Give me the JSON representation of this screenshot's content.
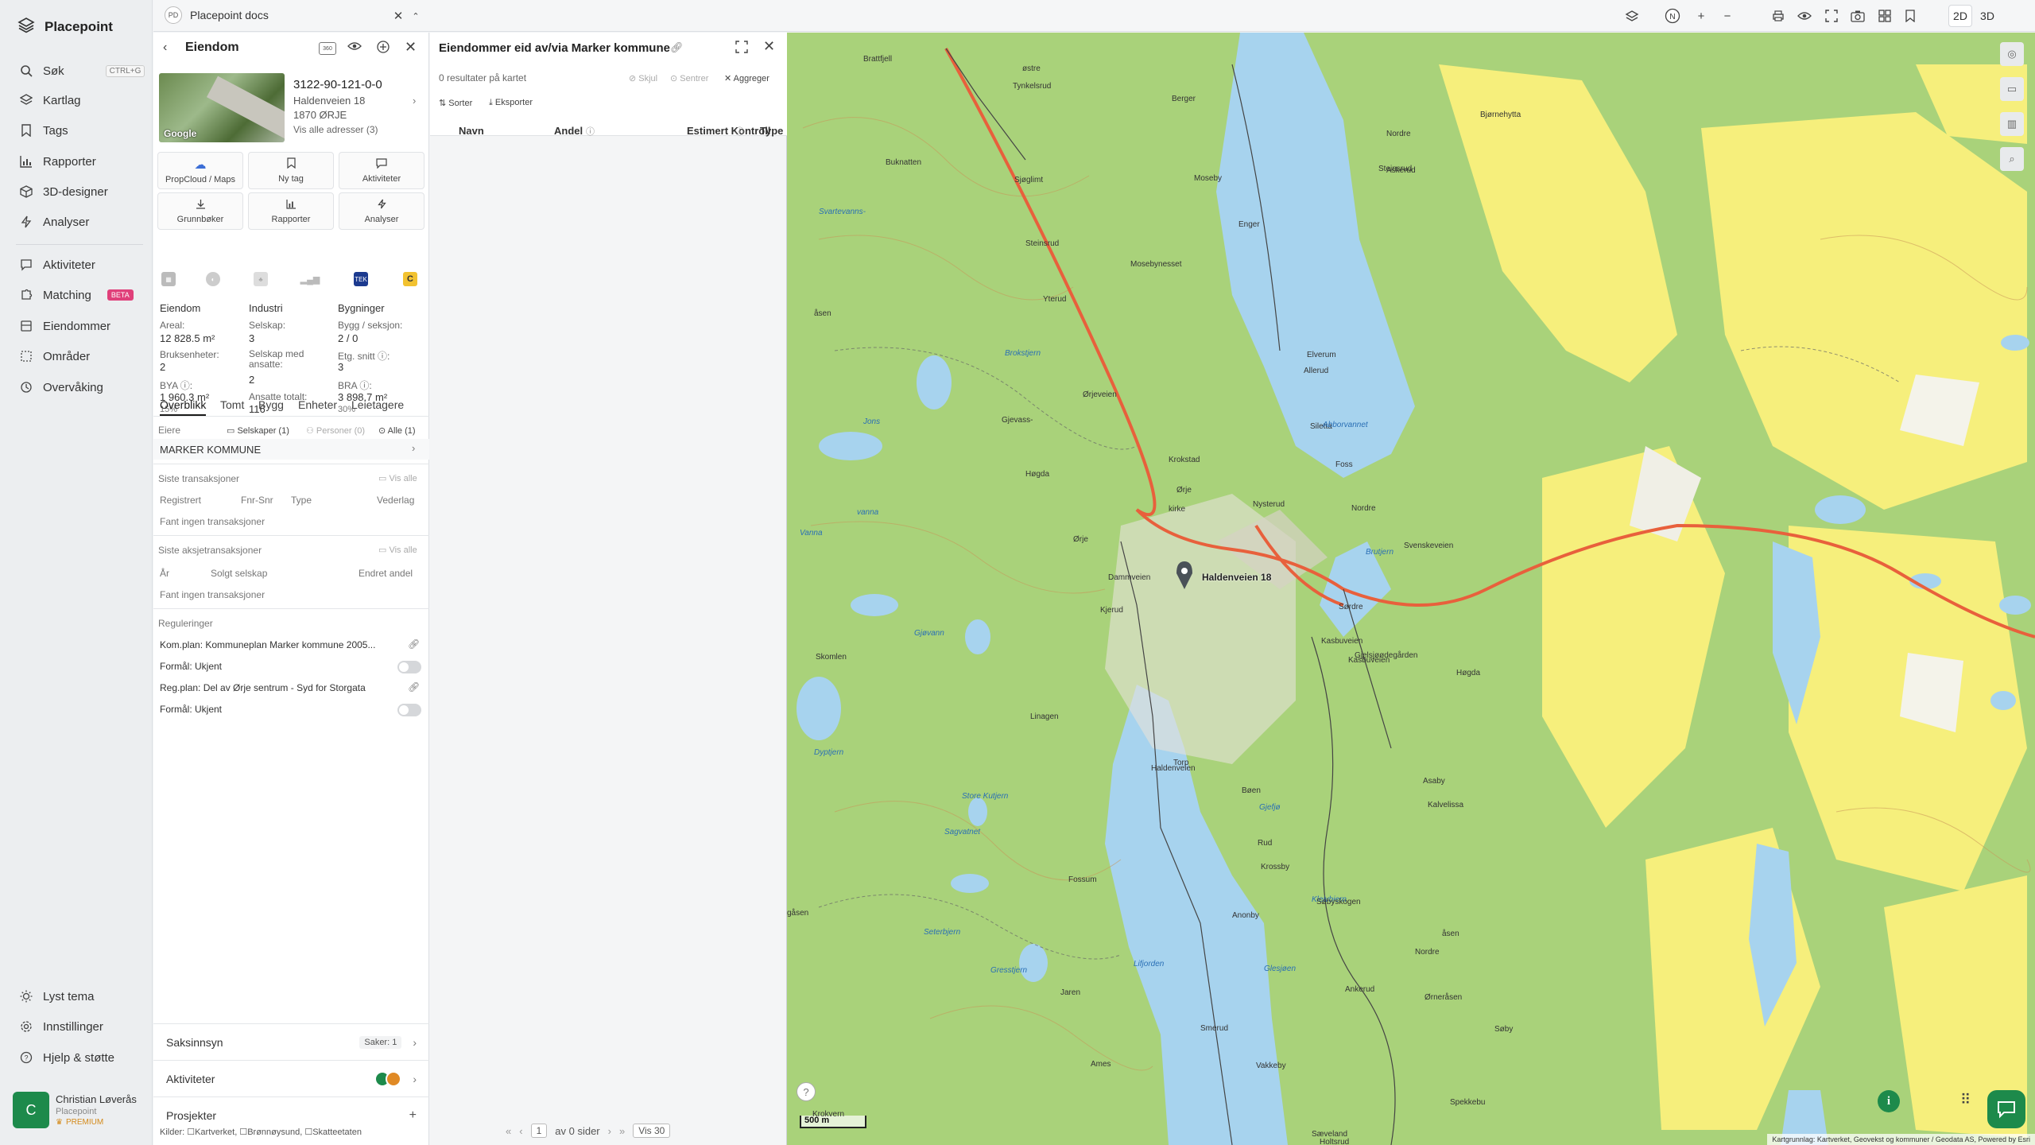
{
  "app": {
    "name": "Placepoint"
  },
  "nav": {
    "items": [
      {
        "label": "Søk",
        "shortcut": "CTRL+G"
      },
      {
        "label": "Kartlag"
      },
      {
        "label": "Tags"
      },
      {
        "label": "Rapporter"
      },
      {
        "label": "3D-designer"
      },
      {
        "label": "Analyser"
      },
      {
        "label": "Aktiviteter"
      },
      {
        "label": "Matching",
        "badge": "BETA"
      },
      {
        "label": "Eiendommer"
      },
      {
        "label": "Områder"
      },
      {
        "label": "Overvåking"
      }
    ],
    "bottom": [
      {
        "label": "Lyst tema"
      },
      {
        "label": "Innstillinger"
      },
      {
        "label": "Hjelp & støtte"
      }
    ],
    "user": {
      "initial": "C",
      "name": "Christian Løverås",
      "org": "Placepoint",
      "plan": "PREMIUM"
    }
  },
  "topbar": {
    "doc_badge": "PD",
    "doc_title": "Placepoint docs",
    "mode_2d": "2D",
    "mode_3d": "3D"
  },
  "property": {
    "header": "Eiendom",
    "id": "3122-90-121-0-0",
    "street": "Haldenveien 18",
    "postal": "1870 ØRJE",
    "all_addresses": "Vis alle adresser (3)",
    "thumb_logo": "Google",
    "actions": [
      "PropCloud / Maps",
      "Ny tag",
      "Aktiviteter",
      "Grunnbøker",
      "Rapporter",
      "Analyser"
    ],
    "tiny_logos": [
      "TEK",
      "C"
    ],
    "stats": {
      "col1_title": "Eiendom",
      "areal_label": "Areal:",
      "areal_value": "12 828.5 m²",
      "bruks_label": "Bruksenheter:",
      "bruks_value": "2",
      "bya_label": "BYA ⓘ:",
      "bya_value": "1 960.3 m²",
      "bya_pct": "15%",
      "col2_title": "Industri",
      "selskap_label": "Selskap:",
      "selskap_value": "3",
      "ansatte_label": "Selskap med ansatte:",
      "ansatte_value": "2",
      "ansatte_tot_label": "Ansatte totalt:",
      "ansatte_tot_value": "116",
      "col3_title": "Bygninger",
      "bygg_label": "Bygg / seksjon:",
      "bygg_value": "2 / 0",
      "etg_label": "Etg. snitt ⓘ:",
      "etg_value": "3",
      "bra_label": "BRA ⓘ:",
      "bra_value": "3 898.7 m²",
      "bra_pct": "30%"
    },
    "tabs": [
      "Overblikk",
      "Tomt",
      "Bygg",
      "Enheter",
      "Leietagere"
    ],
    "owners": {
      "label": "Eiere",
      "selskaper": "Selskaper (1)",
      "personer": "Personer (0)",
      "alle": "Alle (1)",
      "name": "MARKER KOMMUNE"
    },
    "transactions": {
      "title": "Siste transaksjoner",
      "show_all": "Vis alle",
      "cols": [
        "Registrert",
        "Fnr-Snr",
        "Type",
        "Vederlag"
      ],
      "empty": "Fant ingen transaksjoner"
    },
    "share_transactions": {
      "title": "Siste aksjetransaksjoner",
      "show_all": "Vis alle",
      "cols": [
        "År",
        "Solgt selskap",
        "Endret andel"
      ],
      "empty": "Fant ingen transaksjoner"
    },
    "regulations": {
      "title": "Reguleringer",
      "items": [
        {
          "plan": "Kom.plan: Kommuneplan Marker kommune 2005...",
          "purpose": "Formål: Ukjent"
        },
        {
          "plan": "Reg.plan: Del av Ørje sentrum - Syd for Storgata",
          "purpose": "Formål: Ukjent"
        }
      ]
    },
    "accordion": {
      "saksinnsyn": "Saksinnsyn",
      "saker": "Saker: 1",
      "aktiviteter": "Aktiviteter",
      "prosjekter": "Prosjekter"
    },
    "sources": "Kilder: ☐Kartverket, ☐Brønnøysund, ☐Skatteetaten"
  },
  "results": {
    "title": "Eiendommer eid av/via Marker kommune",
    "count": "0 resultater på kartet",
    "skjul": "Skjul",
    "sentrer": "Sentrer",
    "aggreger": "Aggreger",
    "sorter": "Sorter",
    "eksporter": "Eksporter",
    "columns": [
      "Navn",
      "Andel",
      "Estimert Kontroll",
      "Type"
    ],
    "pager": {
      "page": "1",
      "of_pages": "av 0 sider",
      "per_page": "Vis 30"
    }
  },
  "map": {
    "scale": "500 m",
    "attribution": "Kartgrunnlag: Kartverket, Geovekst og kommuner / Geodata AS, Powered by Esri",
    "marker_label": "Haldenveien 18",
    "colors": {
      "forest": "#a9d27a",
      "field": "#f6ef7c",
      "water": "#a7d3ee",
      "road": "#e8603c"
    },
    "places": [
      {
        "name": "Brattfjell"
      },
      {
        "name": "østre"
      },
      {
        "name": "Tynkelsrud"
      },
      {
        "name": "Berger"
      },
      {
        "name": "Buknatten"
      },
      {
        "name": "Sjøglimt"
      },
      {
        "name": "Moseby"
      },
      {
        "name": "Enger"
      },
      {
        "name": "Steinsrud"
      },
      {
        "name": "Nordre"
      },
      {
        "name": "Askerud"
      },
      {
        "name": "Bjørnehytta"
      },
      {
        "name": "Svartevanns-"
      },
      {
        "name": "Steinsrud"
      },
      {
        "name": "åsen"
      },
      {
        "name": "Yterud"
      },
      {
        "name": "Mosebynesset"
      },
      {
        "name": "Brokstjern"
      },
      {
        "name": "Gjevass-"
      },
      {
        "name": "Høgda"
      },
      {
        "name": "Ørjeveien"
      },
      {
        "name": "Krokstad"
      },
      {
        "name": "Ørje"
      },
      {
        "name": "kirke"
      },
      {
        "name": "Siletta"
      },
      {
        "name": "Allerud"
      },
      {
        "name": "Elverum"
      },
      {
        "name": "Abborvannet"
      },
      {
        "name": "Nysterud"
      },
      {
        "name": "Foss"
      },
      {
        "name": "Svenskeveien"
      },
      {
        "name": "Nordre"
      },
      {
        "name": "Brutjern"
      },
      {
        "name": "Sørdre"
      },
      {
        "name": "Jons"
      },
      {
        "name": "vanna"
      },
      {
        "name": "Vanna"
      },
      {
        "name": "Ørje"
      },
      {
        "name": "Kjerud"
      },
      {
        "name": "Dammveien"
      },
      {
        "name": "Kasbuveien"
      },
      {
        "name": "Gjelsjøødegården"
      },
      {
        "name": "Høgda"
      },
      {
        "name": "Skomlen"
      },
      {
        "name": "Gjøvann"
      },
      {
        "name": "Linagen"
      },
      {
        "name": "Haldenveien"
      },
      {
        "name": "Torp"
      },
      {
        "name": "Dyptjern"
      },
      {
        "name": "Store Kutjern"
      },
      {
        "name": "Sagvatnet"
      },
      {
        "name": "Fossum"
      },
      {
        "name": "Rud"
      },
      {
        "name": "Krossby"
      },
      {
        "name": "Kleivbjern"
      },
      {
        "name": "Seterbjern"
      },
      {
        "name": "Gresstjern"
      },
      {
        "name": "Lifjorden"
      },
      {
        "name": "Anonby"
      },
      {
        "name": "Søbyskogen"
      },
      {
        "name": "Jaren"
      },
      {
        "name": "Nordre"
      },
      {
        "name": "Ankerud"
      },
      {
        "name": "Smerud"
      },
      {
        "name": "Søby"
      },
      {
        "name": "Ørneråsen"
      },
      {
        "name": "Ames"
      },
      {
        "name": "Vakkeby"
      },
      {
        "name": "Spekkebu"
      },
      {
        "name": "Sæveland"
      },
      {
        "name": "Holtsrud"
      },
      {
        "name": "Krokvern"
      },
      {
        "name": "Glesjøen"
      },
      {
        "name": "Bøen"
      },
      {
        "name": "Gjefjø"
      },
      {
        "name": "åsen"
      },
      {
        "name": "Kalvelissa"
      },
      {
        "name": "Asaby"
      },
      {
        "name": "Kasbuveien"
      },
      {
        "name": "gåsen"
      }
    ]
  }
}
